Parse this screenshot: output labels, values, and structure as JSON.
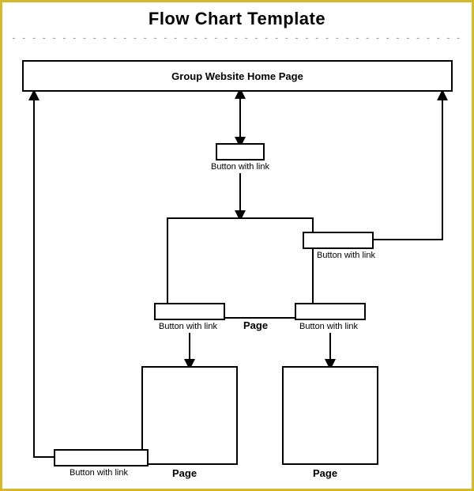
{
  "title": "Flow Chart Template",
  "nodes": {
    "home": {
      "label": "Group Website Home Page"
    },
    "btn_top": {
      "caption": "Button with link"
    },
    "page_mid": {
      "caption": "Page"
    },
    "btn_tr": {
      "caption": "Button with link"
    },
    "btn_left": {
      "caption": "Button with link"
    },
    "btn_right": {
      "caption": "Button with link"
    },
    "page_bl": {
      "caption": "Page"
    },
    "page_br": {
      "caption": "Page"
    },
    "btn_bl": {
      "caption": "Button with link"
    }
  },
  "chart_data": {
    "type": "flowchart",
    "title": "Flow Chart Template",
    "nodes": [
      {
        "id": "home",
        "label": "Group Website Home Page",
        "kind": "page"
      },
      {
        "id": "btn_top",
        "label": "Button with link",
        "kind": "button"
      },
      {
        "id": "page_mid",
        "label": "Page",
        "kind": "page"
      },
      {
        "id": "btn_tr",
        "label": "Button with link",
        "kind": "button",
        "attached_to": "page_mid"
      },
      {
        "id": "btn_left",
        "label": "Button with link",
        "kind": "button",
        "attached_to": "page_mid"
      },
      {
        "id": "btn_right",
        "label": "Button with link",
        "kind": "button",
        "attached_to": "page_mid"
      },
      {
        "id": "page_bl",
        "label": "Page",
        "kind": "page"
      },
      {
        "id": "btn_bl",
        "label": "Button with link",
        "kind": "button",
        "attached_to": "page_bl"
      },
      {
        "id": "page_br",
        "label": "Page",
        "kind": "page"
      }
    ],
    "edges": [
      {
        "from": "home",
        "to": "btn_top",
        "dir": "both"
      },
      {
        "from": "btn_top",
        "to": "page_mid",
        "dir": "forward"
      },
      {
        "from": "btn_left",
        "to": "page_bl",
        "dir": "forward"
      },
      {
        "from": "btn_right",
        "to": "page_br",
        "dir": "forward"
      },
      {
        "from": "btn_tr",
        "to": "home",
        "dir": "forward",
        "route": "right-side"
      },
      {
        "from": "btn_bl",
        "to": "home",
        "dir": "forward",
        "route": "left-side"
      }
    ]
  }
}
